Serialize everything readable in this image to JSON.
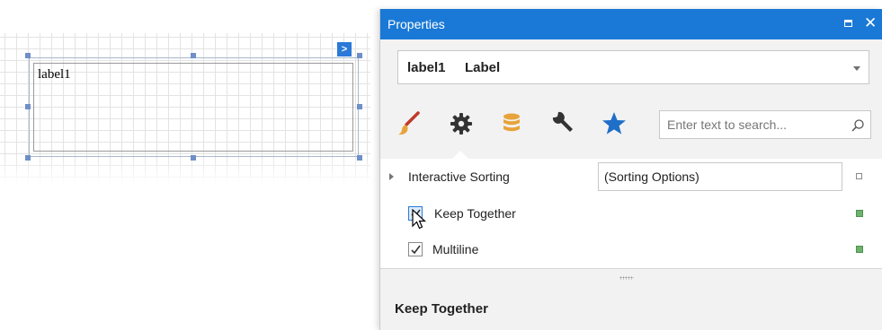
{
  "design_surface": {
    "label_text": "label1",
    "smart_tag_glyph": ">"
  },
  "properties_panel": {
    "title": "Properties",
    "maximize_icon": "maximize-icon",
    "close_glyph": "✕",
    "object_selector": {
      "name": "label1",
      "type": "Label"
    },
    "tabs": [
      {
        "icon": "brush-icon",
        "label": "Appearance",
        "color": "#c0392b"
      },
      {
        "icon": "gear-icon",
        "label": "Behavior",
        "color": "#333333",
        "selected": true
      },
      {
        "icon": "database-icon",
        "label": "Data",
        "color": "#e8a33a"
      },
      {
        "icon": "wrench-icon",
        "label": "Design",
        "color": "#333333"
      },
      {
        "icon": "star-icon",
        "label": "Favorites",
        "color": "#1f6fc9"
      }
    ],
    "search": {
      "placeholder": "Enter text to search...",
      "value": ""
    },
    "rows": [
      {
        "name": "Interactive Sorting",
        "value": "(Sorting Options)",
        "expandable": true,
        "modified": false
      },
      {
        "name": "Keep Together",
        "checked": true,
        "modified": true
      },
      {
        "name": "Multiline",
        "checked": true,
        "modified": true
      }
    ],
    "description": {
      "title": "Keep Together"
    },
    "colors": {
      "accent": "#1a79d6",
      "modified_marker": "#6db36d"
    }
  }
}
